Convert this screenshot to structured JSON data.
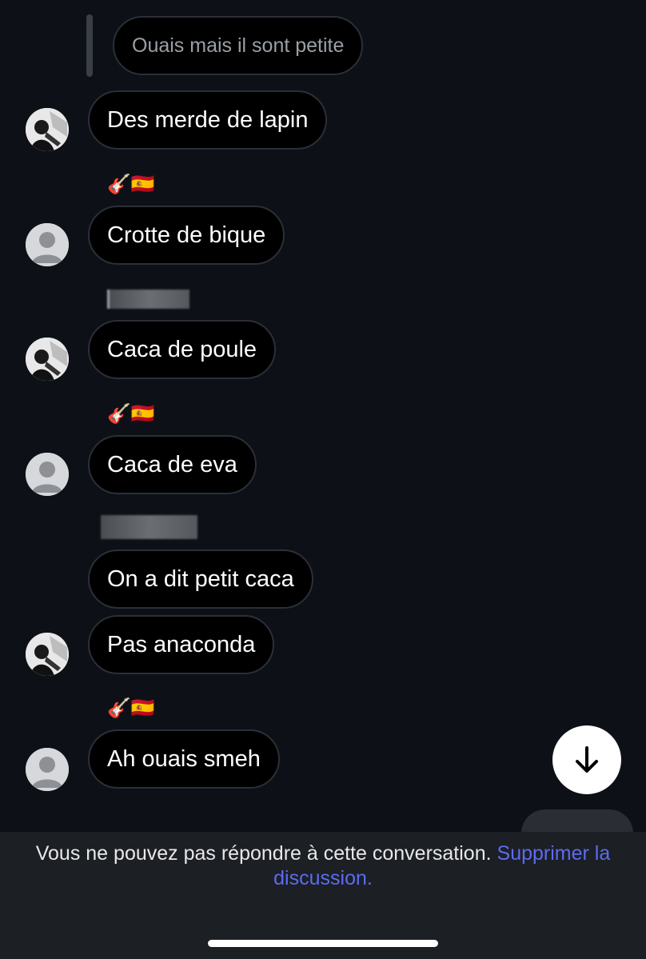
{
  "conversation": {
    "reply_preview": "Ouais mais il sont petite",
    "messages": [
      {
        "text": "Des merde de lapin"
      },
      {
        "text": "Crotte de bique"
      },
      {
        "text": "Caca de poule"
      },
      {
        "text": "Caca de eva"
      },
      {
        "text": "On a dit petit caca"
      },
      {
        "text": "Pas anaconda"
      },
      {
        "text": "Ah ouais smeh"
      }
    ],
    "sender_tag": "🎸🇪🇸"
  },
  "footer": {
    "notice": "Vous ne pouvez pas répondre à cette conversation.",
    "link": "Supprimer la discussion."
  },
  "icons": {
    "scroll_down": "arrow-down-icon",
    "avatar_default": "default-avatar-icon",
    "avatar_photo": "profile-photo-icon"
  },
  "colors": {
    "background": "#0d1117",
    "bubble": "#000000",
    "link": "#5b6cf0",
    "footer_bg": "#1c1f24"
  }
}
